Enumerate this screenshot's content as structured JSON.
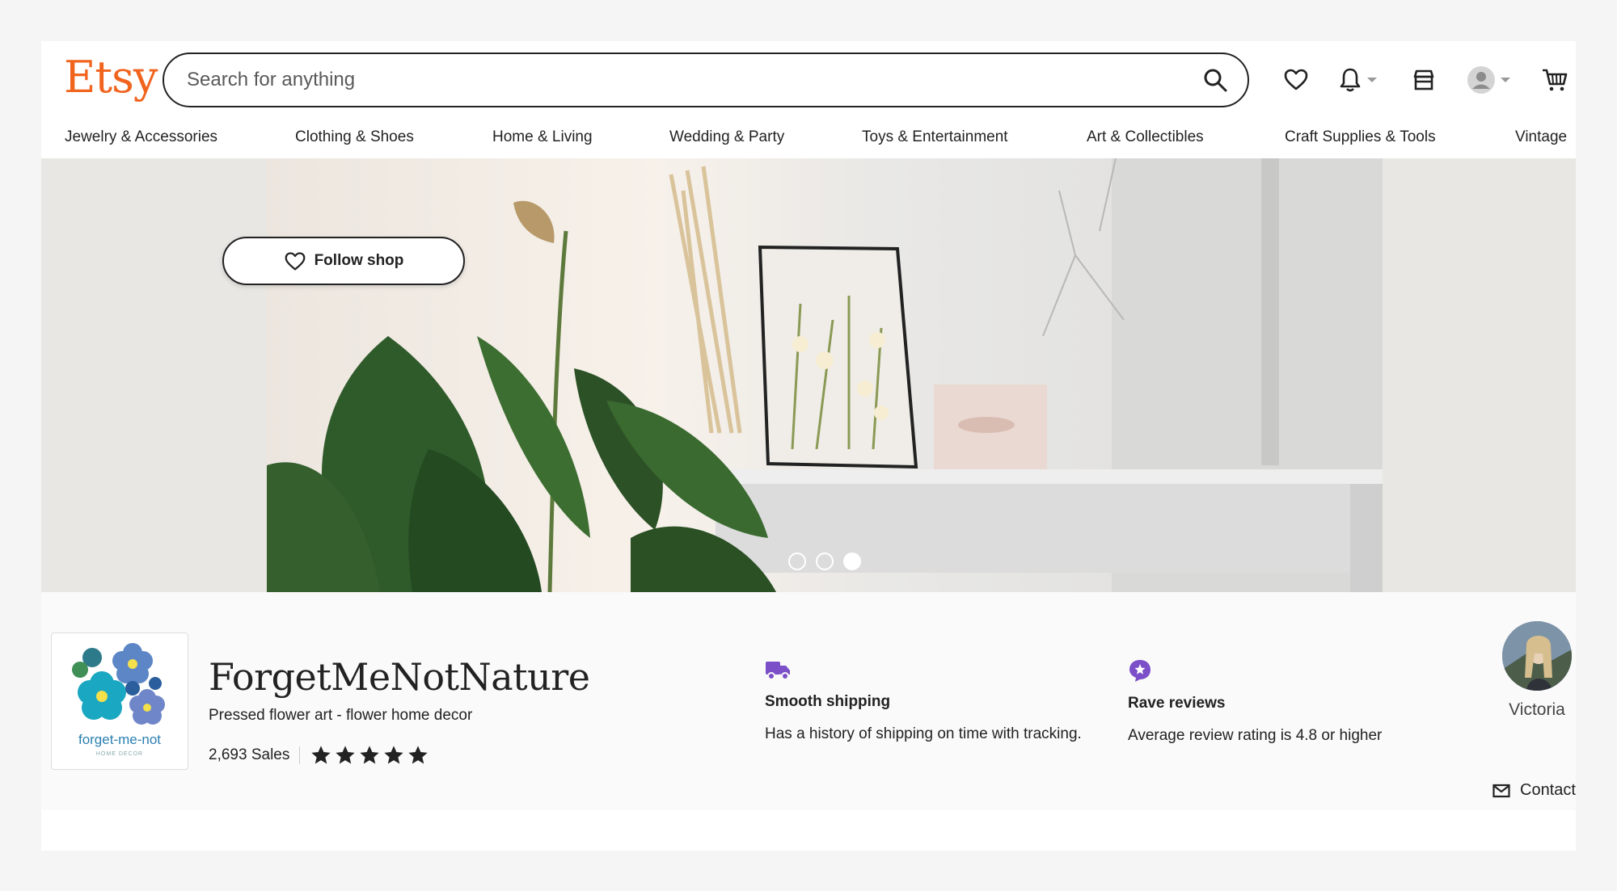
{
  "header": {
    "logo": "Etsy",
    "search_placeholder": "Search for anything"
  },
  "categories": [
    "Jewelry & Accessories",
    "Clothing & Shoes",
    "Home & Living",
    "Wedding & Party",
    "Toys & Entertainment",
    "Art & Collectibles",
    "Craft Supplies & Tools",
    "Vintage"
  ],
  "banner": {
    "slide_count": 3,
    "active_slide": 3
  },
  "shop": {
    "logo_text": "forget-me-not",
    "logo_subtext": "HOME DECOR",
    "name": "ForgetMeNotNature",
    "tagline": "Pressed flower art - flower home decor",
    "sales": "2,693 Sales",
    "rating_stars": 5,
    "follow_label": "Follow shop"
  },
  "features": [
    {
      "icon": "truck-icon",
      "title": "Smooth shipping",
      "text": "Has a history of shipping on time with tracking."
    },
    {
      "icon": "star-badge-icon",
      "title": "Rave reviews",
      "text": "Average review rating is 4.8 or higher"
    }
  ],
  "owner": {
    "name": "Victoria",
    "contact_label": "Contact"
  },
  "colors": {
    "brand": "#f1641e",
    "feature_icon": "#7b4fc8",
    "text": "#222222"
  }
}
